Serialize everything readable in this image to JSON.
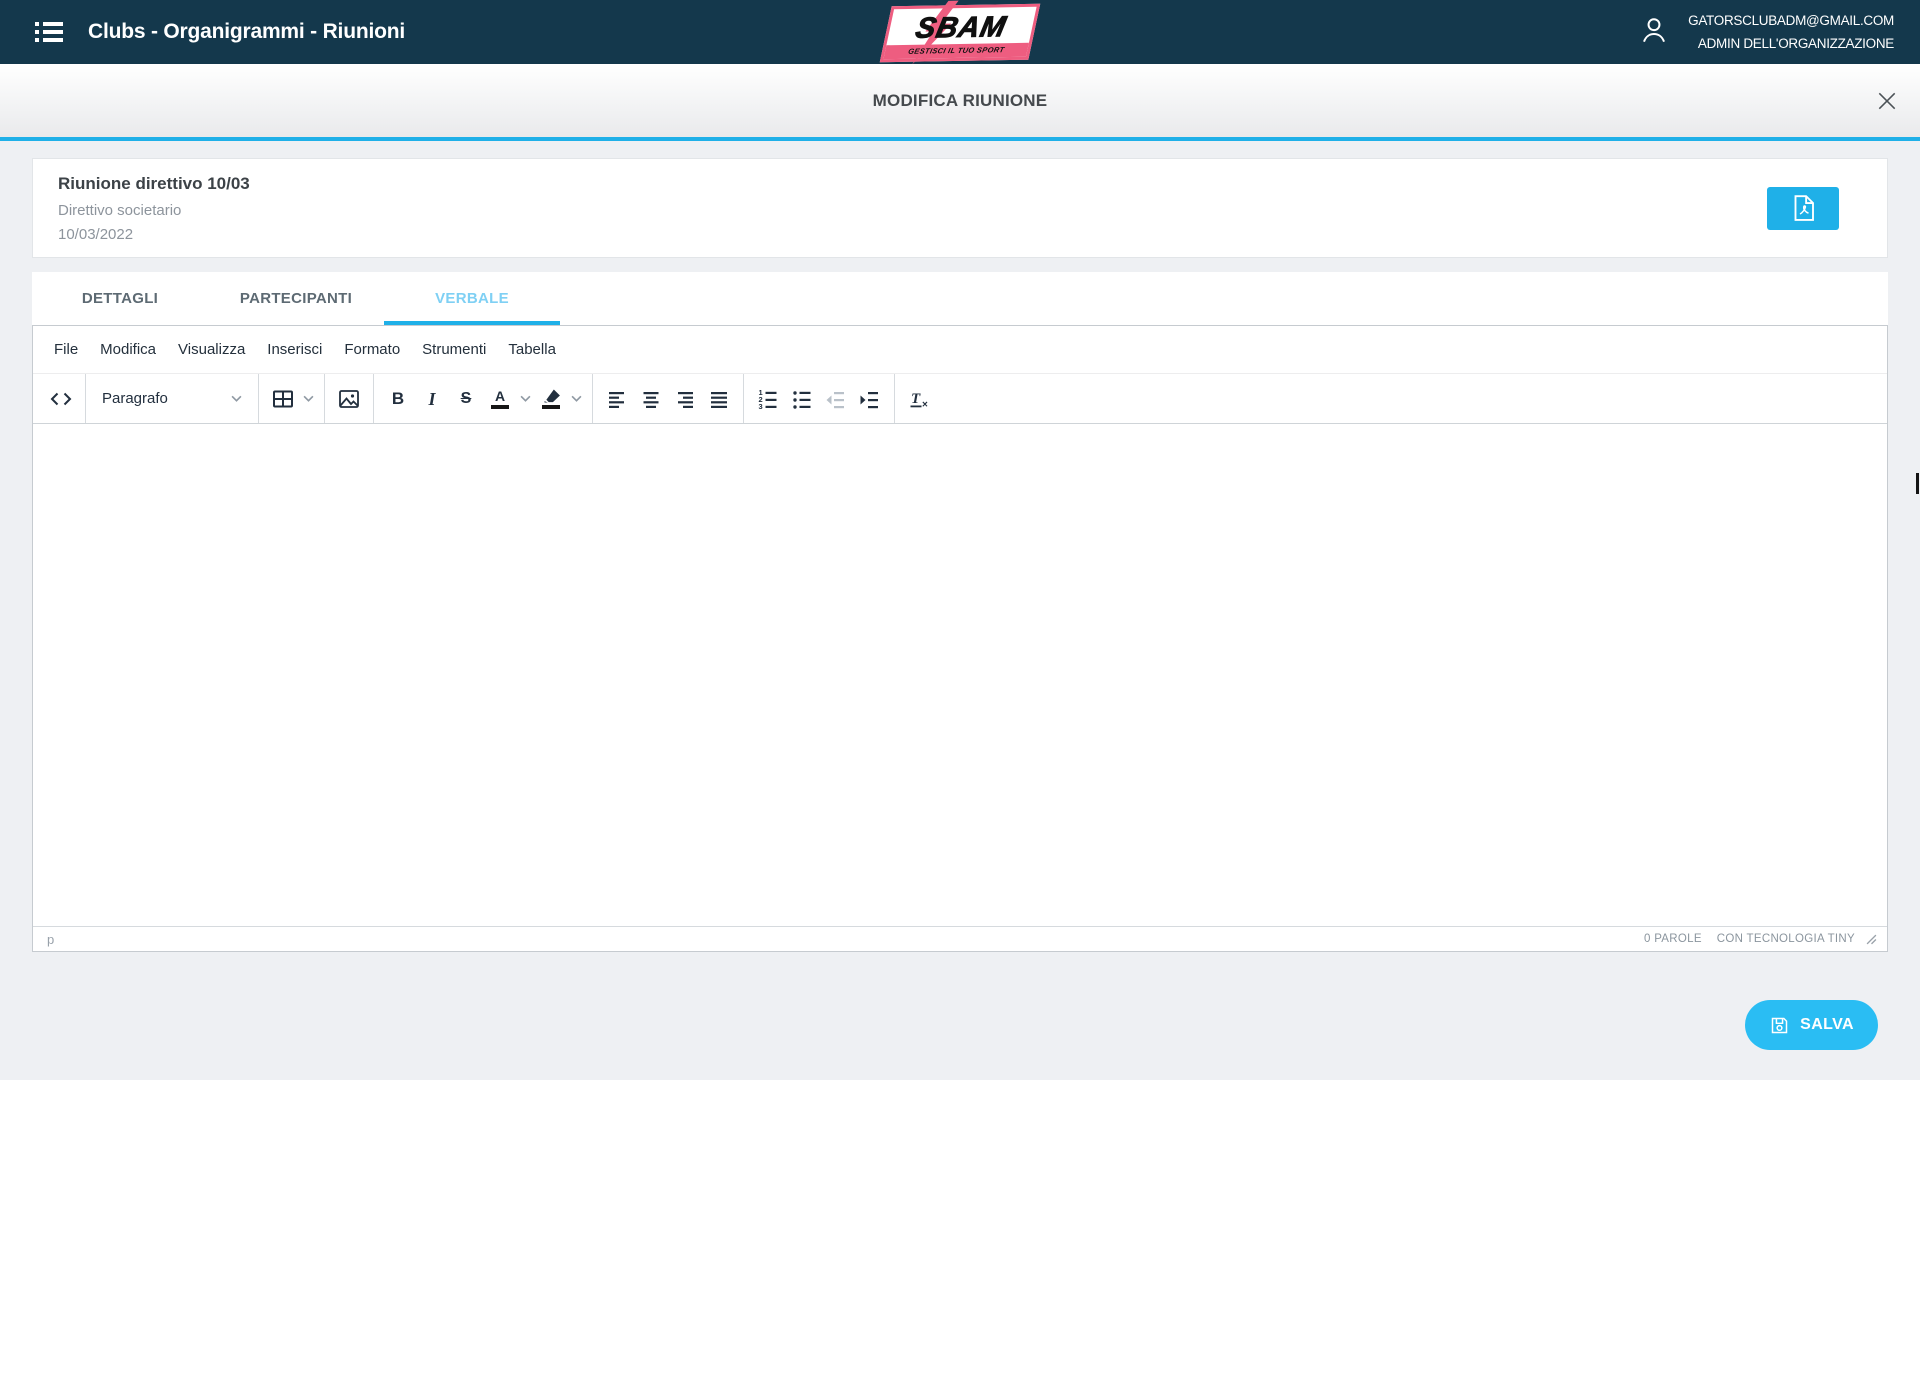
{
  "navbar": {
    "title": "Clubs - Organigrammi - Riunioni",
    "logo": {
      "text": "SBAM",
      "tagline": "GESTISCI IL TUO SPORT"
    },
    "user": {
      "email": "GATORSCLUBADM@GMAIL.COM",
      "role": "ADMIN DELL'ORGANIZZAZIONE"
    }
  },
  "modal": {
    "title": "MODIFICA RIUNIONE"
  },
  "meeting": {
    "title": "Riunione direttivo 10/03",
    "subtitle": "Direttivo societario",
    "date": "10/03/2022"
  },
  "tabs": [
    {
      "label": "DETTAGLI",
      "active": false
    },
    {
      "label": "PARTECIPANTI",
      "active": false
    },
    {
      "label": "VERBALE",
      "active": true
    }
  ],
  "editor": {
    "menu": [
      "File",
      "Modifica",
      "Visualizza",
      "Inserisci",
      "Formato",
      "Strumenti",
      "Tabella"
    ],
    "format_select": "Paragrafo",
    "content": "",
    "statusbar": {
      "element_path": "p",
      "word_count": "0 PAROLE",
      "branding": "CON TECNOLOGIA TINY"
    }
  },
  "actions": {
    "save_label": "SALVA"
  },
  "colors": {
    "navbar_bg": "#14384c",
    "accent": "#1fb0e8",
    "accent_bright": "#2abdf3",
    "tab_active": "#7fd0f4",
    "logo_pink": "#ee5d80",
    "icon": "#222f3e"
  }
}
